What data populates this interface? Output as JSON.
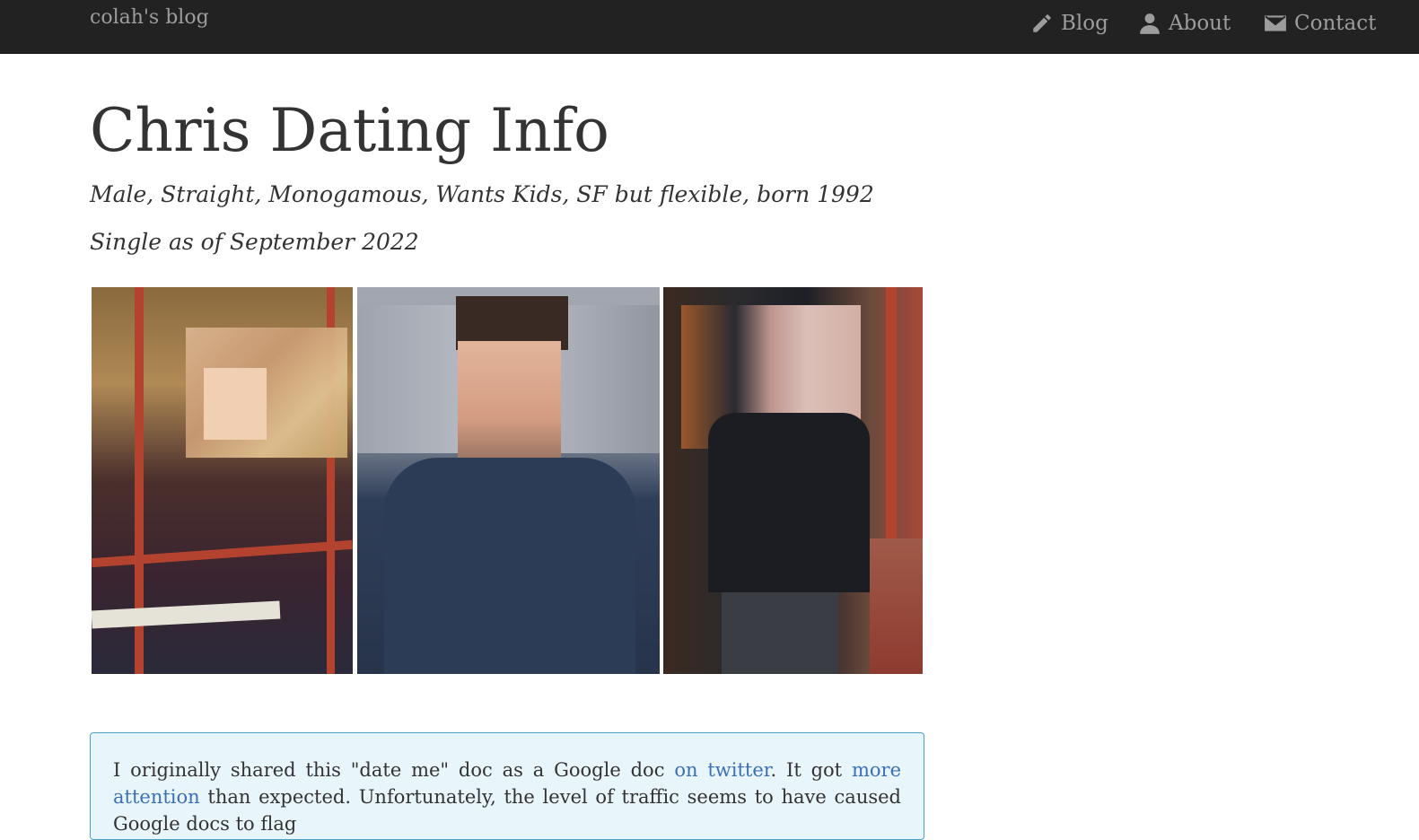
{
  "navbar": {
    "brand": "colah's blog",
    "items": [
      {
        "label": "Blog",
        "icon": "pencil-icon"
      },
      {
        "label": "About",
        "icon": "user-icon"
      },
      {
        "label": "Contact",
        "icon": "envelope-icon"
      }
    ]
  },
  "page": {
    "title": "Chris Dating Info",
    "subtitle": "Male, Straight, Monogamous, Wants Kids, SF but flexible, born 1992",
    "status": "Single as of September 2022"
  },
  "photos": [
    {
      "alt": "photo-sitting-with-book"
    },
    {
      "alt": "photo-blue-shirt"
    },
    {
      "alt": "photo-black-tshirt"
    }
  ],
  "notice": {
    "text_1": "I originally shared this \"date me\" doc as a Google doc ",
    "link_1": "on twitter",
    "text_2": ". It got ",
    "link_2": "more attention",
    "text_3": " than expected. Unfortunately, the level of traffic seems to have caused Google docs to flag"
  },
  "colors": {
    "navbar_bg": "#222222",
    "nav_text": "#9d9d9d",
    "link": "#3b6fb6",
    "notice_bg": "#e8f5fb",
    "notice_border": "#4aa3c7"
  }
}
